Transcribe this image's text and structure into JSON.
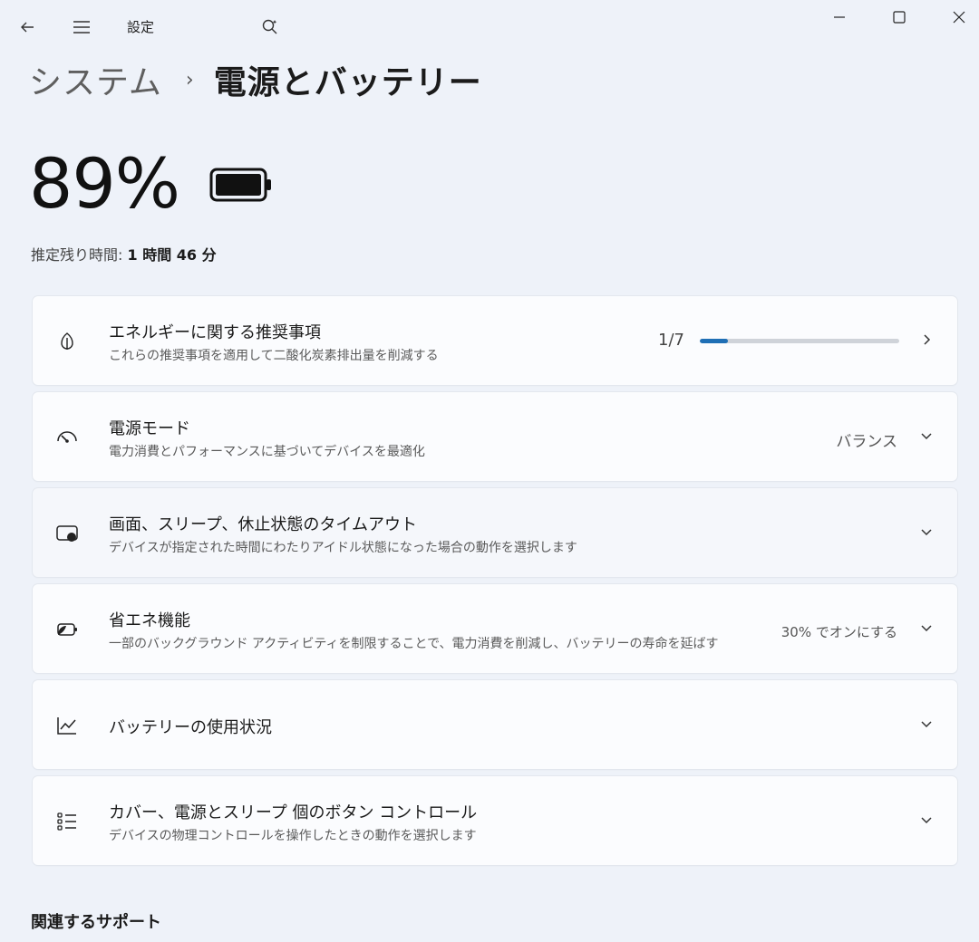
{
  "window": {
    "title": "設定",
    "buttons": {
      "minimize": "minimize-icon",
      "maximize": "maximize-icon",
      "close": "close-icon"
    }
  },
  "breadcrumb": {
    "parent": "システム",
    "separator": "›",
    "current": "電源とバッテリー"
  },
  "battery": {
    "percent_text": "89%",
    "remaining_label": "推定残り時間:",
    "remaining_value": "1 時間 46 分"
  },
  "cards": [
    {
      "icon": "leaf-icon",
      "title": "エネルギーに関する推奨事項",
      "subtitle": "これらの推奨事項を適用して二酸化炭素排出量を削減する",
      "progress_text": "1/7",
      "progress_fraction": 0.143,
      "chevron": "chevron-right-icon"
    },
    {
      "icon": "gauge-icon",
      "title": "電源モード",
      "subtitle": "電力消費とパフォーマンスに基づいてデバイスを最適化",
      "value": "バランス",
      "chevron": "chevron-down-icon"
    },
    {
      "icon": "screen-sleep-icon",
      "title": "画面、スリープ、休止状態のタイムアウト",
      "subtitle": "デバイスが指定された時間にわたりアイドル状態になった場合の動作を選択します",
      "chevron": "chevron-down-icon"
    },
    {
      "icon": "battery-saver-icon",
      "title": "省エネ機能",
      "subtitle": "一部のバックグラウンド アクティビティを制限することで、電力消費を削減し、バッテリーの寿命を延ばす",
      "value": "30% でオンにする",
      "chevron": "chevron-down-icon"
    },
    {
      "icon": "usage-chart-icon",
      "title": "バッテリーの使用状況",
      "chevron": "chevron-down-icon"
    },
    {
      "icon": "button-controls-icon",
      "title": "カバー、電源とスリープ 個のボタン コントロール",
      "subtitle": "デバイスの物理コントロールを操作したときの動作を選択します",
      "chevron": "chevron-down-icon"
    }
  ],
  "related": {
    "title": "関連するサポート"
  },
  "colors": {
    "background": "#eef2f9",
    "card": "#fbfcfe",
    "accent": "#1f6fb5",
    "track": "#cfd3d9"
  }
}
